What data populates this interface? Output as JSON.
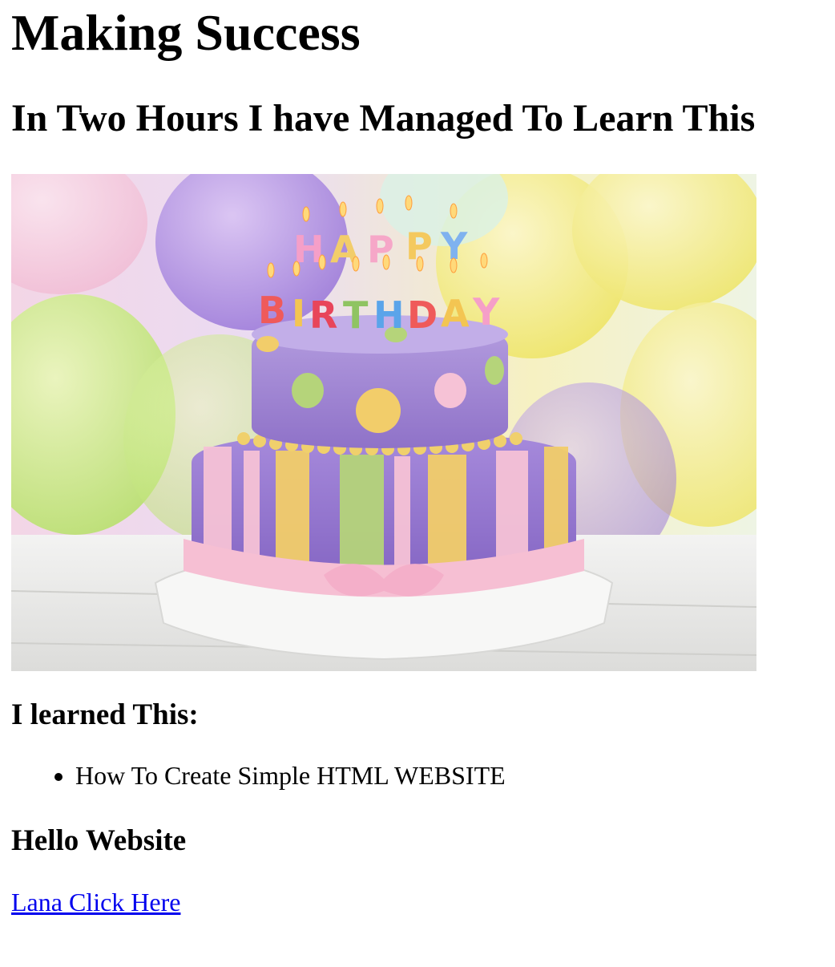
{
  "page": {
    "title": "Making Success",
    "subtitle": "In Two Hours I have Managed To Learn This",
    "learned_heading": "I learned This:",
    "learned_items": [
      "How To Create Simple HTML WEBSITE"
    ],
    "hello_heading": "Hello Website",
    "link_text": "Lana Click Here"
  },
  "image": {
    "subject": "birthday-cake-photo",
    "candle_letters_top": "HAPPY",
    "candle_letters_bottom": "BIRTHDAY"
  },
  "colors": {
    "link": "#0000ee",
    "cake_purple": "#a98fd6",
    "stripe_yellow": "#f2cd6a",
    "stripe_green": "#b5d47a",
    "stripe_pink": "#f6c2d6"
  }
}
